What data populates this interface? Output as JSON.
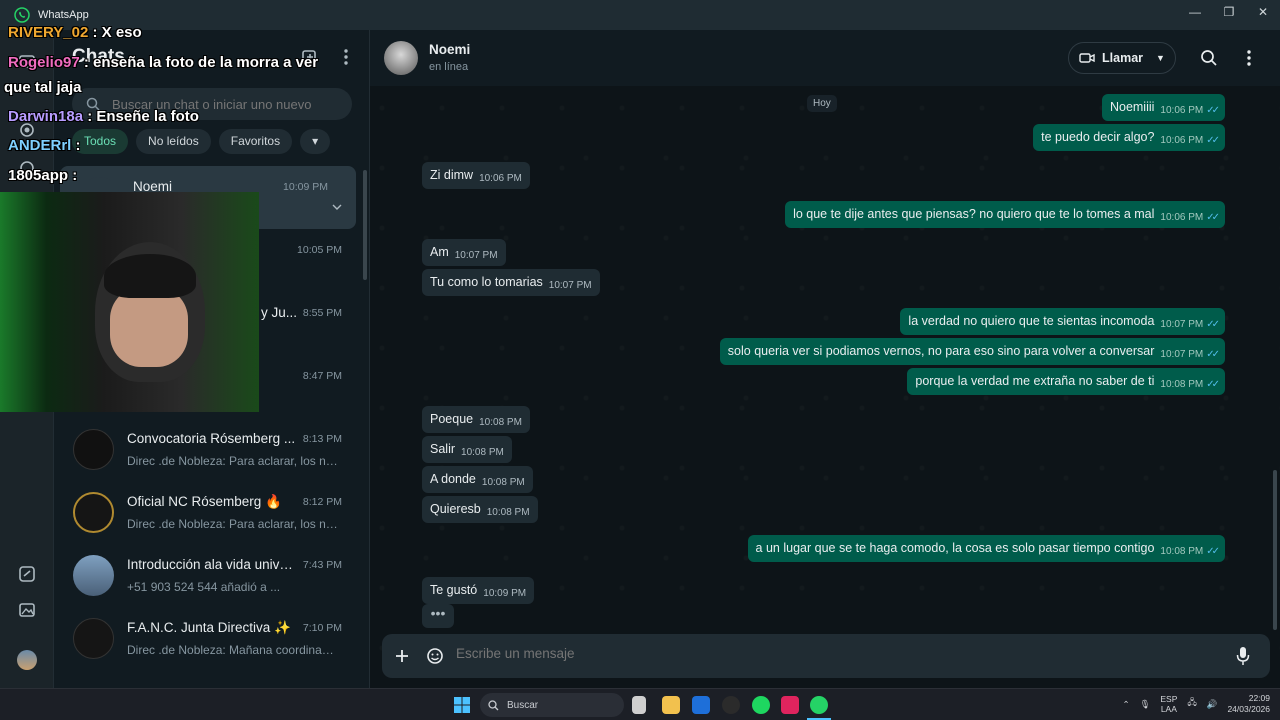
{
  "window": {
    "title": "WhatsApp",
    "controls": [
      "—",
      "❐",
      "✕"
    ]
  },
  "sidebar": {
    "header_title": "Chats",
    "search_placeholder": "Buscar un chat o iniciar uno nuevo",
    "filters": [
      "Todos",
      "No leídos",
      "Favoritos"
    ],
    "chats": [
      {
        "name": "Noemi",
        "time": "10:09 PM",
        "preview": ""
      },
      {
        "name": "",
        "time": "10:05 PM",
        "preview": ""
      },
      {
        "name": "y Ju...",
        "time": "8:55 PM",
        "preview": ""
      },
      {
        "name": "",
        "time": "8:47 PM",
        "preview": ""
      },
      {
        "name": "Convocatoria Rósemberg ...",
        "time": "8:13 PM",
        "preview": "Direc .de Nobleza: Para aclarar, los nue..."
      },
      {
        "name": "Oficial NC Rósemberg 🔥",
        "time": "8:12 PM",
        "preview": "Direc .de Nobleza: Para aclarar, los nue..."
      },
      {
        "name": "Introducción ala vida univer...",
        "time": "7:43 PM",
        "preview": "+51 903 524 544 añadió a ..."
      },
      {
        "name": "F.A.N.C. Junta Directiva ✨",
        "time": "7:10 PM",
        "preview": "Direc .de Nobleza: Mañana coordinam..."
      }
    ]
  },
  "chat": {
    "contact_name": "Noemi",
    "contact_status": "en línea",
    "call_label": "Llamar",
    "day_label": "Hoy",
    "messages": [
      {
        "dir": "out",
        "text": "Noemiiii",
        "time": "10:06 PM"
      },
      {
        "dir": "out",
        "text": "te puedo decir algo?",
        "time": "10:06 PM"
      },
      {
        "dir": "in",
        "text": "Zi dimw",
        "time": "10:06 PM"
      },
      {
        "dir": "out",
        "text": "lo que te dije antes que piensas? no quiero que te lo tomes a mal",
        "time": "10:06 PM"
      },
      {
        "dir": "in",
        "text": "Am",
        "time": "10:07 PM"
      },
      {
        "dir": "in",
        "text": "Tu como lo tomarias",
        "time": "10:07 PM"
      },
      {
        "dir": "out",
        "text": "la verdad no quiero que te sientas incomoda",
        "time": "10:07 PM"
      },
      {
        "dir": "out",
        "text": "solo queria ver si podiamos vernos, no para eso sino para volver a conversar",
        "time": "10:07 PM"
      },
      {
        "dir": "out",
        "text": "porque la verdad me extraña no saber de ti",
        "time": "10:08 PM"
      },
      {
        "dir": "in",
        "text": "Poeque",
        "time": "10:08 PM"
      },
      {
        "dir": "in",
        "text": "Salir",
        "time": "10:08 PM"
      },
      {
        "dir": "in",
        "text": "A donde",
        "time": "10:08 PM"
      },
      {
        "dir": "in",
        "text": "Quieresb",
        "time": "10:08 PM"
      },
      {
        "dir": "out",
        "text": "a un lugar que se te haga comodo, la cosa es solo pasar tiempo contigo",
        "time": "10:08 PM"
      },
      {
        "dir": "in",
        "text": "Te gustó",
        "time": "10:09 PM"
      }
    ],
    "typing": "•••",
    "composer_placeholder": "Escribe un mensaje"
  },
  "overlay": {
    "lines": [
      {
        "user": "RIVERY_02",
        "text": " : X eso"
      },
      {
        "user": "Rogelio97",
        "text": " : enseña la foto de la morra a ver"
      },
      {
        "user": "",
        "text": "que tal jaja"
      },
      {
        "user": "Darwin18a",
        "text": " : Enseñe la foto"
      },
      {
        "user": "ANDERrl",
        "text": " :"
      },
      {
        "user": "1805app",
        "text": " :"
      }
    ]
  },
  "taskbar": {
    "search_label": "Buscar",
    "lang": "ESP",
    "lang_sub": "LAA",
    "time": "22:09",
    "date": "24/03/2026"
  },
  "colors": {
    "accent": "#00a884",
    "outgoing_bubble": "#005c4b",
    "incoming_bubble": "#1f2c33",
    "read_tick": "#53bdeb"
  }
}
